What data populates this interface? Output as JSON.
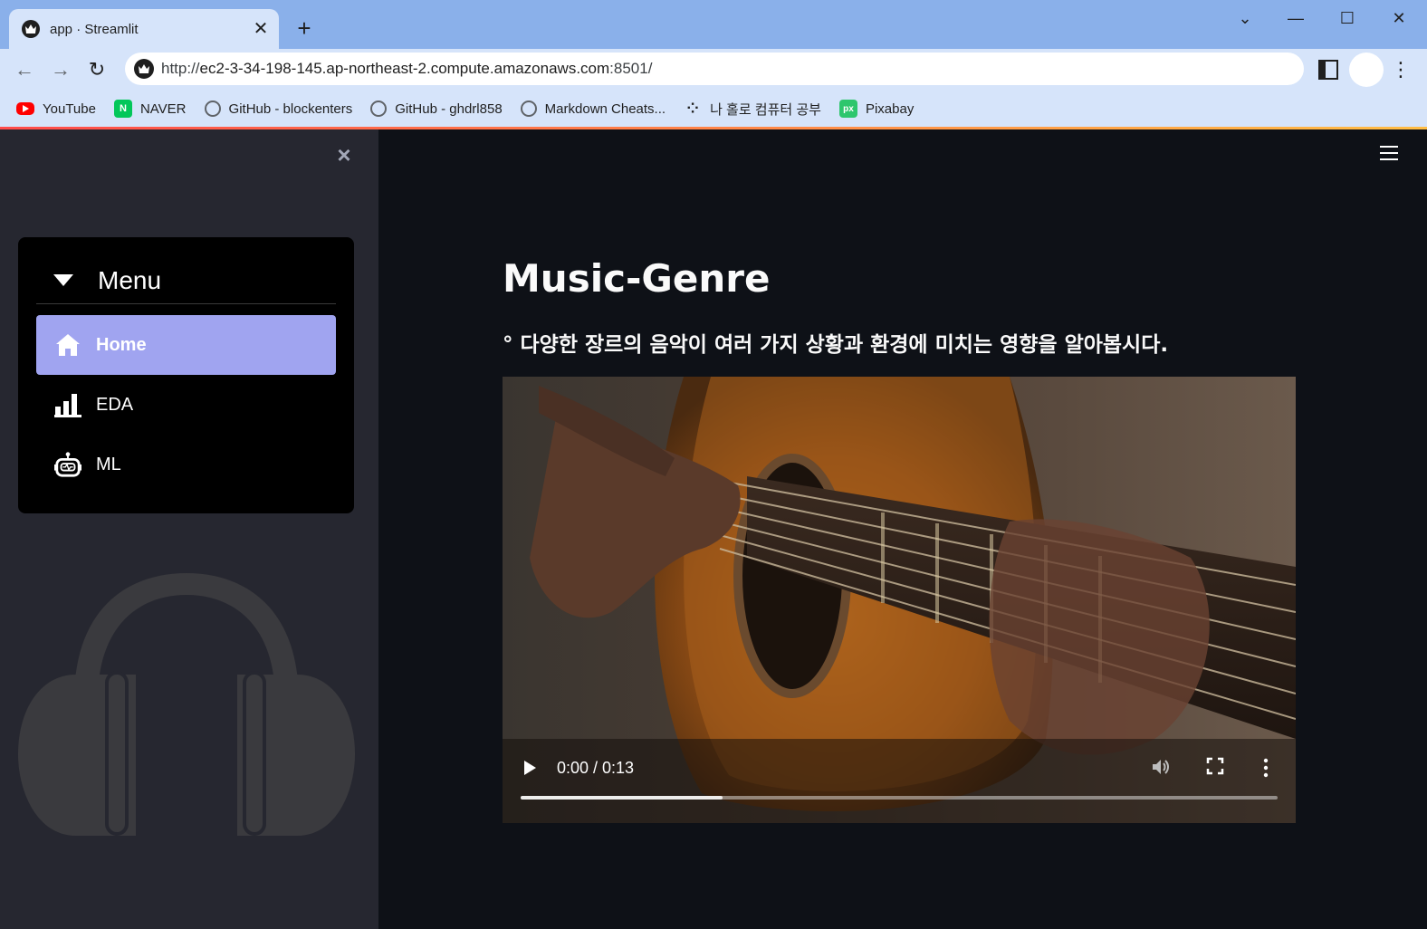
{
  "browser": {
    "tab_title": "app · Streamlit",
    "tab_close": "✕",
    "new_tab": "+",
    "url_scheme": "http://",
    "url_host": "ec2-3-34-198-145.ap-northeast-2.compute.amazonaws.com",
    "url_rest": ":8501/",
    "window_controls": [
      "⌄",
      "—",
      "☐",
      "✕"
    ],
    "nav": {
      "back": "←",
      "forward": "→",
      "reload": "↻"
    },
    "bookmarks": [
      {
        "label": "YouTube",
        "icon": "youtube-icon"
      },
      {
        "label": "NAVER",
        "icon": "naver-icon",
        "glyph": "N"
      },
      {
        "label": "GitHub - blockenters",
        "icon": "github-icon"
      },
      {
        "label": "GitHub - ghdrl858",
        "icon": "github-icon"
      },
      {
        "label": "Markdown Cheats...",
        "icon": "github-icon"
      },
      {
        "label": "나 홀로 컴퓨터 공부",
        "icon": "dots-icon",
        "glyph": "⁘"
      },
      {
        "label": "Pixabay",
        "icon": "pixabay-icon",
        "glyph": "px"
      }
    ]
  },
  "sidebar": {
    "close": "×",
    "menu_title": "Menu",
    "items": [
      {
        "label": "Home",
        "icon": "home-icon",
        "active": true
      },
      {
        "label": "EDA",
        "icon": "bar-chart-icon",
        "active": false
      },
      {
        "label": "ML",
        "icon": "robot-icon",
        "active": false
      }
    ],
    "active_color": "#a0a4f0"
  },
  "main": {
    "title": "Music-Genre",
    "subtitle": "° 다양한 장르의 음악이 여러 가지 상황과 환경에 미치는 영향을 알아봅시다.",
    "video": {
      "time": "0:00 / 0:13",
      "buffered_fraction": 0.267
    }
  },
  "colors": {
    "app_bg": "#0e1117",
    "sidebar_bg": "#262730",
    "chrome_bg": "#8ab0ea"
  }
}
